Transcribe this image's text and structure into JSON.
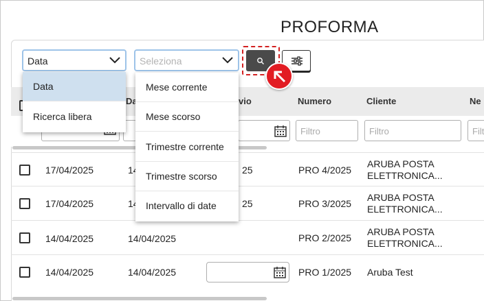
{
  "page": {
    "title": "PROFORMA"
  },
  "toolbar": {
    "select1_value": "Data",
    "select2_placeholder": "Seleziona",
    "search_icon": "search-icon",
    "filter_icon": "sliders-icon"
  },
  "menu1": {
    "items": [
      "Data",
      "Ricerca libera"
    ],
    "selected": "Data"
  },
  "menu2": {
    "items": [
      "Mese corrente",
      "Mese scorso",
      "Trimestre corrente",
      "Trimestre scorso",
      "Intervallo di date"
    ]
  },
  "table": {
    "columns": [
      "D",
      "Da",
      "vio",
      "Numero",
      "Cliente",
      "Ne"
    ],
    "filter_placeholder": "Filtro",
    "filter_placeholder_partial": "Filtro",
    "rows": [
      {
        "date1": "17/04/2025",
        "date2": "14",
        "sent": "25",
        "number": "PRO 4/2025",
        "client_line1": "ARUBA POSTA",
        "client_line2": "ELETTRONICA..."
      },
      {
        "date1": "17/04/2025",
        "date2": "14",
        "sent": "25",
        "number": "PRO 3/2025",
        "client_line1": "ARUBA POSTA",
        "client_line2": "ELETTRONICA..."
      },
      {
        "date1": "14/04/2025",
        "date2": "14/04/2025",
        "sent": "",
        "number": "PRO 2/2025",
        "client_line1": "ARUBA POSTA",
        "client_line2": "ELETTRONICA..."
      },
      {
        "date1": "14/04/2025",
        "date2": "14/04/2025",
        "sent": "",
        "number": "PRO 1/2025",
        "client_line1": "Aruba Test",
        "client_line2": ""
      }
    ]
  },
  "colors": {
    "accent_border": "#9dc3e8",
    "selected_bg": "#cfe0ef",
    "badge_red": "#e21c23",
    "dark_button": "#4a4a4a"
  }
}
